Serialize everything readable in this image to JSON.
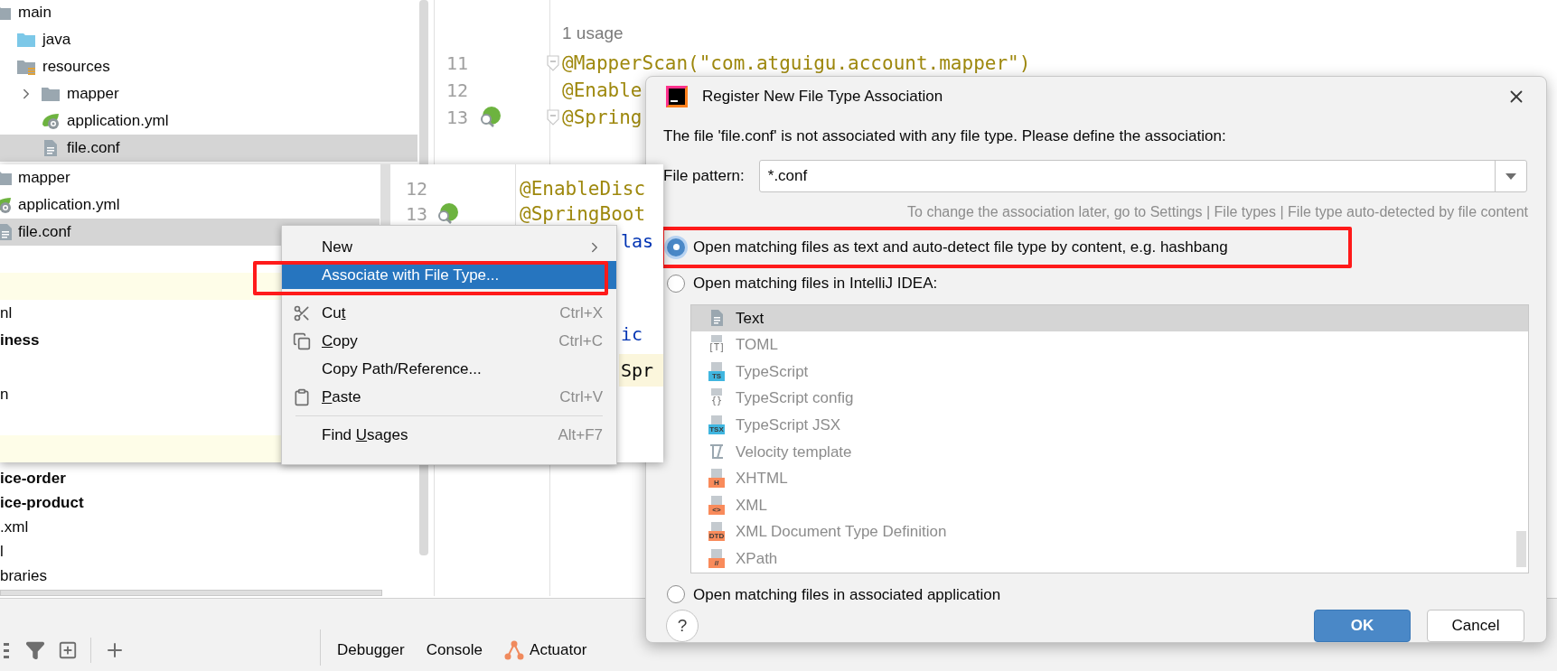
{
  "ide": {
    "project_tree": [
      {
        "label": "main",
        "kind": "folder",
        "selected": false,
        "children": [
          {
            "label": "java",
            "kind": "source-folder",
            "selected": false
          },
          {
            "label": "resources",
            "kind": "resources-folder",
            "selected": false,
            "children": [
              {
                "label": "mapper",
                "kind": "folder",
                "selected": false,
                "expanded": false
              },
              {
                "label": "application.yml",
                "kind": "spring-config",
                "selected": false
              },
              {
                "label": "file.conf",
                "kind": "text-file",
                "selected": true
              }
            ]
          }
        ]
      }
    ],
    "project_tree_lower": [
      {
        "label": "ice-order",
        "bold": true
      },
      {
        "label": "ice-product",
        "bold": true
      },
      {
        "label": ".xml",
        "bold": false
      },
      {
        "label": "l",
        "bold": false
      },
      {
        "label": "braries",
        "bold": false
      }
    ],
    "editor_lines": [
      {
        "kind": "hint",
        "text": "1 usage"
      },
      {
        "kind": "code",
        "number": "11",
        "code": "@MapperScan(\"com.atguigu.account.mapper\")",
        "color": "#9e880d",
        "fold": true,
        "bean": false
      },
      {
        "kind": "code",
        "number": "12",
        "code": "@Enable",
        "color": "#9e880d",
        "fold": false,
        "bean": false
      },
      {
        "kind": "code",
        "number": "13",
        "code": "@Spring",
        "color": "#9e880d",
        "fold": true,
        "bean": true
      }
    ],
    "tool_tabs": [
      {
        "label": "Debugger",
        "kind": "plain"
      },
      {
        "label": "Console",
        "kind": "plain"
      },
      {
        "label": "Actuator",
        "kind": "actuator"
      }
    ]
  },
  "front": {
    "project_tree": [
      {
        "kind": "folder",
        "label": "mapper",
        "selected": false,
        "highlighted": false
      },
      {
        "kind": "spring-config",
        "label": "application.yml",
        "selected": false,
        "highlighted": false
      },
      {
        "kind": "text-file",
        "label": "file.conf",
        "selected": true,
        "highlighted": false
      },
      {
        "kind": "blank",
        "highlighted": false
      },
      {
        "kind": "blank",
        "highlighted": true
      },
      {
        "kind": "plain",
        "label": "nl",
        "bold": false,
        "selected": false,
        "highlighted": false
      },
      {
        "kind": "plain",
        "label": "iness",
        "bold": true,
        "selected": false,
        "highlighted": false
      },
      {
        "kind": "blank",
        "highlighted": false
      },
      {
        "kind": "plain",
        "label": "n",
        "bold": false,
        "selected": false,
        "highlighted": false
      },
      {
        "kind": "blank",
        "highlighted": false
      },
      {
        "kind": "blank",
        "highlighted": true
      }
    ],
    "editor_lines": [
      {
        "kind": "code",
        "number": "12",
        "code": "@EnableDisc",
        "color": "#9e880d",
        "bean": false
      },
      {
        "kind": "code",
        "number": "13",
        "code": "@SpringBoot",
        "color": "#9e880d",
        "bean": true
      },
      {
        "kind": "clipped",
        "code": "las",
        "color": "#0033b3",
        "highlighted": false
      },
      {
        "kind": "blank"
      },
      {
        "kind": "clipped",
        "code": "ic",
        "color": "#0033b3",
        "highlighted": false
      },
      {
        "kind": "clipped",
        "code": "Spr",
        "color": "#080808",
        "highlighted": true
      }
    ]
  },
  "context_menu": {
    "items": [
      {
        "kind": "item",
        "label_start": "New",
        "submenu": true,
        "selected": false,
        "annotated": false
      },
      {
        "kind": "item",
        "label_start": "Associate with File Type...",
        "submenu": false,
        "selected": true,
        "annotated": true
      },
      {
        "kind": "separator"
      },
      {
        "kind": "cut",
        "label_start": "Cu",
        "mnemonic": "t",
        "shortcut": "Ctrl+X",
        "submenu": false,
        "selected": false,
        "annotated": false
      },
      {
        "kind": "copy",
        "mnemonic": "C",
        "label_end": "opy",
        "shortcut": "Ctrl+C",
        "submenu": false,
        "selected": false,
        "annotated": false
      },
      {
        "kind": "item",
        "label_start": "Copy Path/Reference...",
        "submenu": false,
        "selected": false,
        "annotated": false
      },
      {
        "kind": "paste",
        "mnemonic": "P",
        "label_end": "aste",
        "shortcut": "Ctrl+V",
        "submenu": false,
        "selected": false,
        "annotated": false
      },
      {
        "kind": "separator"
      },
      {
        "kind": "item",
        "label_start": "Find ",
        "mnemonic": "U",
        "label_end": "sages",
        "shortcut": "Alt+F7",
        "submenu": false,
        "selected": false,
        "annotated": false
      }
    ]
  },
  "dialog": {
    "title": "Register New File Type Association",
    "description": "The file 'file.conf' is not associated with any file type. Please define the association:",
    "pattern_label": "File pattern:",
    "pattern_value": "*.conf",
    "hint": "To change the association later, go to Settings | File types | File type auto-detected by file content",
    "options": [
      {
        "label": "Open matching files as text and auto-detect file type by content, e.g. hashbang",
        "selected": true,
        "annotated": true
      },
      {
        "label": "Open matching files in IntelliJ IDEA:",
        "selected": false,
        "annotated": false
      },
      {
        "label": "Open matching files in associated application",
        "selected": false,
        "annotated": false
      }
    ],
    "file_types": [
      {
        "label": "Text",
        "kind": "text",
        "selected": true,
        "disabled": false
      },
      {
        "label": "TOML",
        "kind": "glyph",
        "badge": "[T]",
        "selected": false,
        "disabled": true
      },
      {
        "label": "TypeScript",
        "kind": "badge",
        "badge": "TS",
        "color": "#40b6e0",
        "selected": false,
        "disabled": true
      },
      {
        "label": "TypeScript config",
        "kind": "glyph",
        "badge": "{}",
        "selected": false,
        "disabled": true
      },
      {
        "label": "TypeScript JSX",
        "kind": "badge",
        "badge": "TSX",
        "color": "#40b6e0",
        "selected": false,
        "disabled": true
      },
      {
        "label": "Velocity template",
        "kind": "velocity",
        "selected": false,
        "disabled": true
      },
      {
        "label": "XHTML",
        "kind": "badge",
        "badge": "H",
        "color": "#f98b5b",
        "selected": false,
        "disabled": true
      },
      {
        "label": "XML",
        "kind": "badge",
        "badge": "<>",
        "color": "#f98b5b",
        "selected": false,
        "disabled": true
      },
      {
        "label": "XML Document Type Definition",
        "kind": "badge",
        "badge": "DTD",
        "color": "#f98b5b",
        "selected": false,
        "disabled": true
      },
      {
        "label": "XPath",
        "kind": "badge",
        "badge": "//",
        "color": "#f98b5b",
        "selected": false,
        "disabled": true
      }
    ],
    "help": "?",
    "buttons": [
      {
        "label": "OK",
        "kind": "primary"
      },
      {
        "label": "Cancel",
        "kind": "secondary"
      }
    ]
  }
}
